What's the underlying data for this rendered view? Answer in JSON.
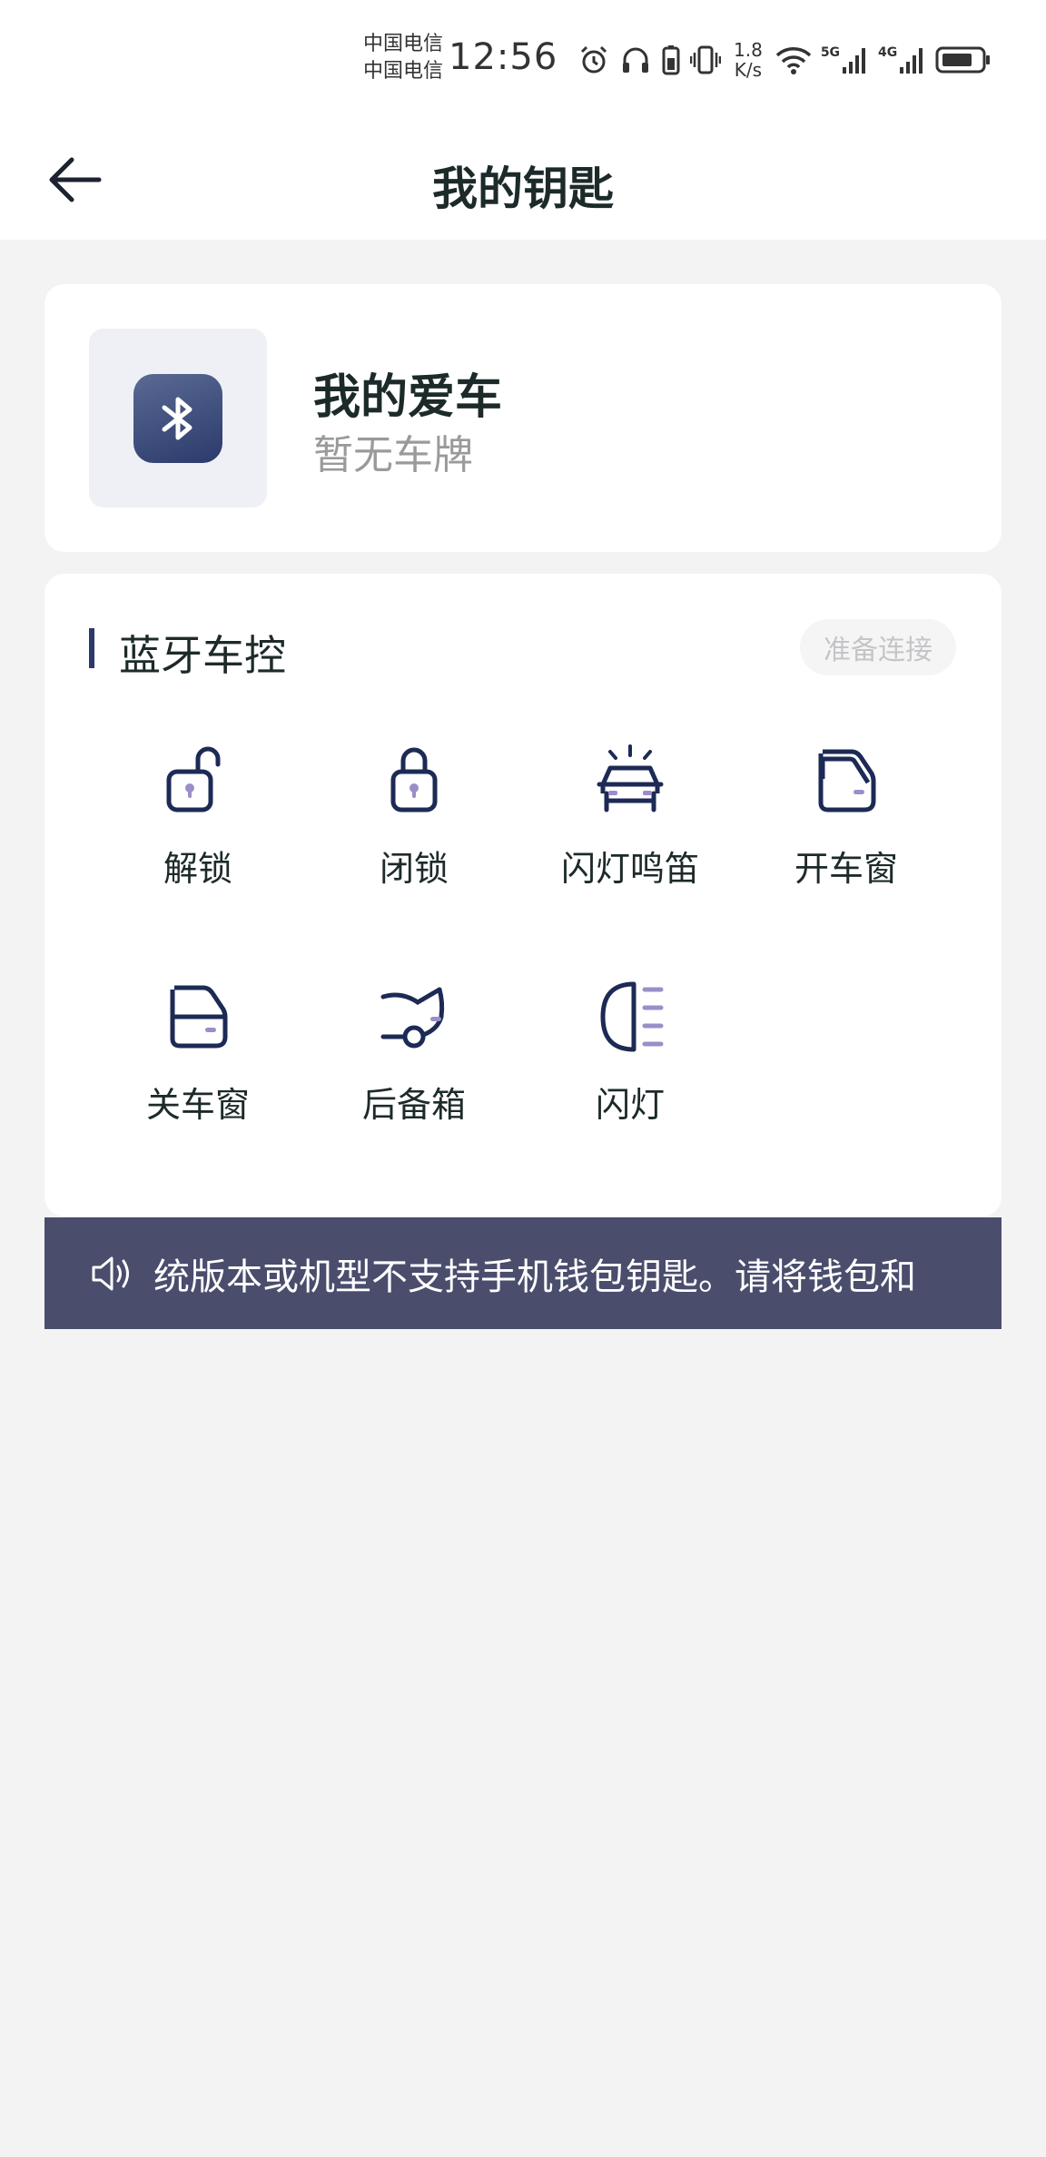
{
  "status_bar": {
    "carrier_1": "中国电信",
    "carrier_2": "中国电信",
    "time": "12:56",
    "speed_value": "1.8",
    "speed_unit": "K/s",
    "net_1": "5G",
    "net_2": "4G",
    "icons": [
      "alarm-icon",
      "headphones-icon",
      "battery-saver-icon",
      "vibrate-icon",
      "wifi-icon",
      "signal-icon",
      "signal-icon",
      "battery-icon"
    ]
  },
  "header": {
    "title": "我的钥匙",
    "back_icon": "back-arrow-icon"
  },
  "car": {
    "name": "我的爱车",
    "plate": "暂无车牌",
    "icon": "bluetooth-icon"
  },
  "bluetooth_control": {
    "title": "蓝牙车控",
    "status": "准备连接",
    "controls": [
      {
        "label": "解锁",
        "icon": "unlock-icon"
      },
      {
        "label": "闭锁",
        "icon": "lock-icon"
      },
      {
        "label": "闪灯鸣笛",
        "icon": "flash-horn-icon"
      },
      {
        "label": "开车窗",
        "icon": "open-window-icon"
      },
      {
        "label": "关车窗",
        "icon": "close-window-icon"
      },
      {
        "label": "后备箱",
        "icon": "trunk-icon"
      },
      {
        "label": "闪灯",
        "icon": "headlight-icon"
      }
    ]
  },
  "notice": {
    "icon": "speaker-icon",
    "text": "统版本或机型不支持手机钱包钥匙。请将钱包和"
  },
  "colors": {
    "accent": "#2b3a6b",
    "notice_bg": "#4a4d6c",
    "icon_highlight": "#9b8ec9",
    "page_bg": "#f3f3f4"
  }
}
